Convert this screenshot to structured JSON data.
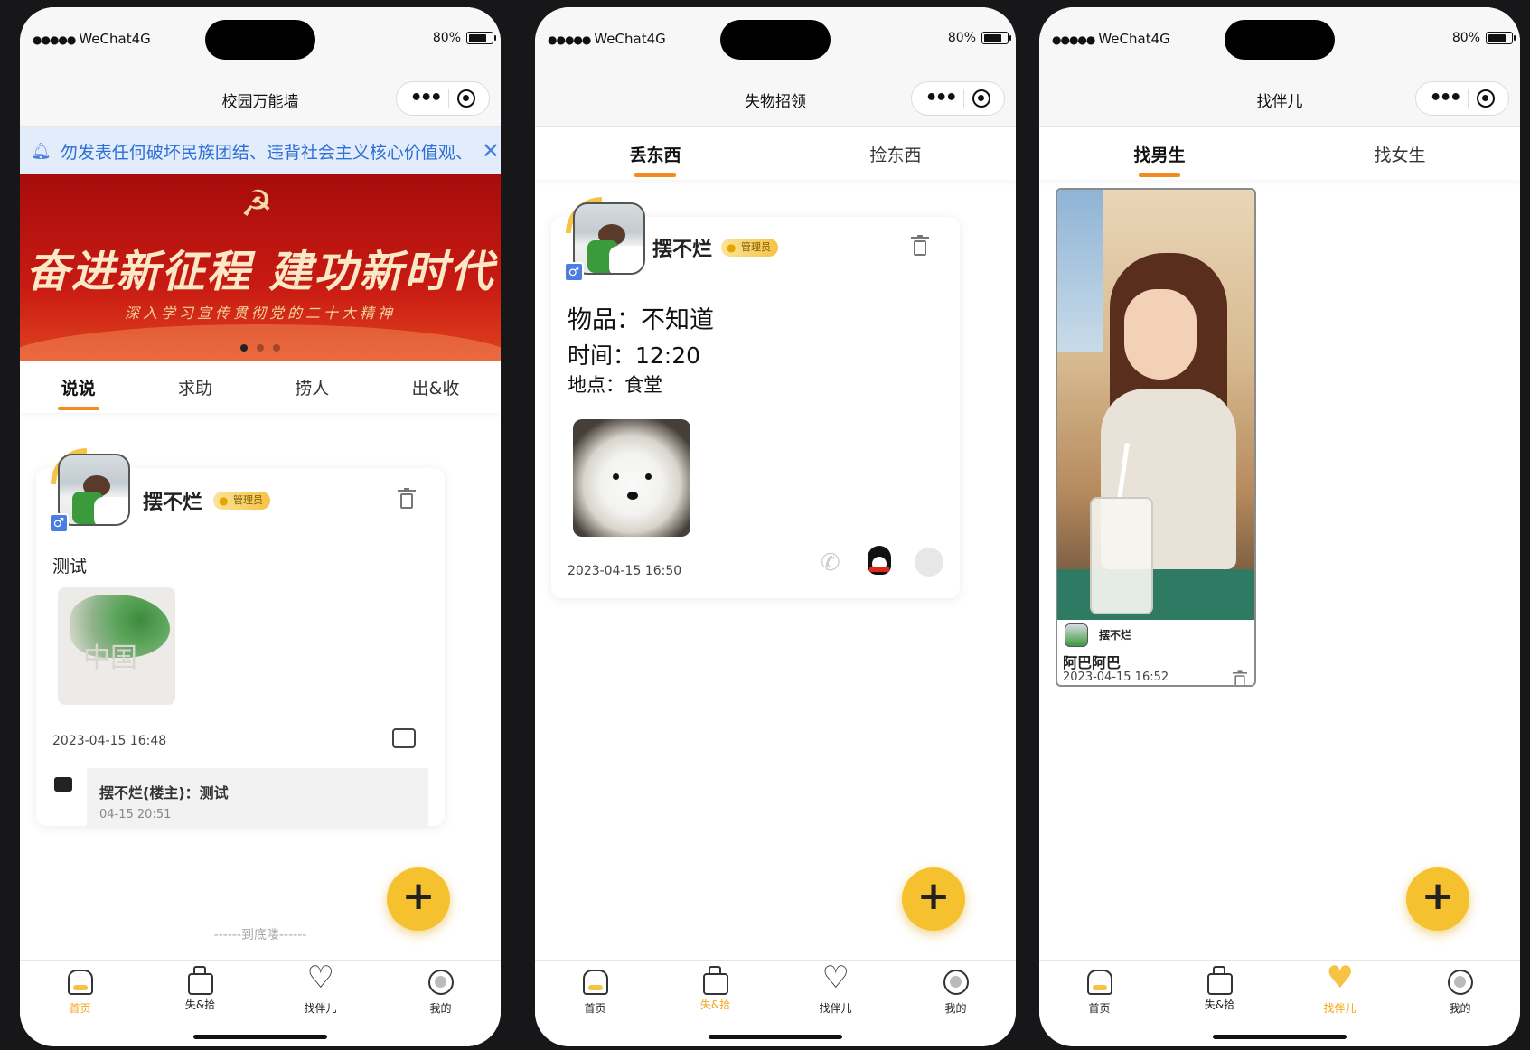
{
  "status": {
    "carrier": "WeChat4G",
    "battery": "80%"
  },
  "screens": [
    {
      "nav_title": "校园万能墙",
      "notice": "勿发表任何破坏民族团结、违背社会主义核心价值观、",
      "banner": {
        "title": "奋进新征程 建功新时代",
        "subtitle": "深入学习宣传贯彻党的二十大精神"
      },
      "tabs": [
        "说说",
        "求助",
        "捞人",
        "出&收"
      ],
      "post": {
        "username": "摆不烂",
        "badge": "管理员",
        "text": "测试",
        "image_text": "中国",
        "time": "2023-04-15 16:48",
        "reply_author": "摆不烂(楼主)：测试",
        "reply_time": "04-15 20:51"
      },
      "footer": "------到底喽------",
      "active_tab": 0
    },
    {
      "nav_title": "失物招领",
      "tabs": [
        "丢东西",
        "捡东西"
      ],
      "post": {
        "username": "摆不烂",
        "badge": "管理员",
        "item_label": "物品：不知道",
        "time_label": "时间：12:20",
        "place_label": "地点：食堂",
        "time": "2023-04-15 16:50"
      },
      "active_tab": 1
    },
    {
      "nav_title": "找伴儿",
      "tabs": [
        "找男生",
        "找女生"
      ],
      "post": {
        "username": "摆不烂",
        "title": "阿巴阿巴",
        "time": "2023-04-15 16:52"
      },
      "active_tab": 2
    }
  ],
  "tabbar": [
    "首页",
    "失&拾",
    "找伴儿",
    "我的"
  ],
  "colors": {
    "accent": "#f6c12f",
    "tab_underline": "#f58a1f",
    "notice_bg": "#e2ecfb",
    "notice_text": "#2f6fd6",
    "banner_red": "#c81a12"
  }
}
